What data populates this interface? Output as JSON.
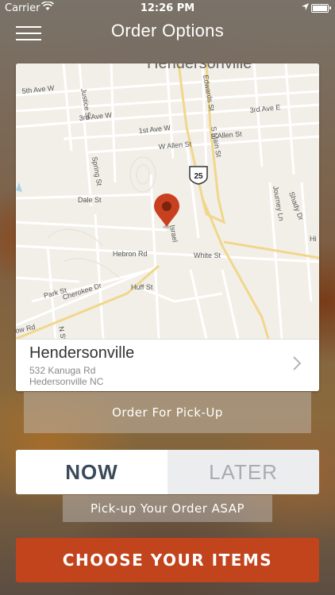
{
  "status_bar": {
    "carrier": "Carrier",
    "time": "12:26 PM"
  },
  "header": {
    "title": "Order Options"
  },
  "map": {
    "city_label": "Hendersonville",
    "route_shield": "25",
    "streets": [
      "5th Ave W",
      "Justice St",
      "3rd Ave W",
      "1st Ave W",
      "W Allen St",
      "E Allen St",
      "Edwards St",
      "S Main St",
      "3rd Ave E",
      "Spring St",
      "Dale St",
      "Journey Ln",
      "Shady Dr",
      "Israel",
      "Hebron Rd",
      "White St",
      "Park St",
      "Cherokee Dr",
      "Huff St",
      "ow Rd",
      "N St",
      "Hi"
    ]
  },
  "location": {
    "name": "Hendersonville",
    "address_line1": "532 Kanuga Rd",
    "address_line2": "Hedersonville NC"
  },
  "order_type": {
    "label": "Order For Pick-Up"
  },
  "timing": {
    "now_label": "NOW",
    "later_label": "LATER",
    "selected": "now",
    "note": "Pick-up Your Order ASAP"
  },
  "cta": {
    "label": "CHOOSE YOUR ITEMS"
  },
  "colors": {
    "accent": "#c1441d",
    "pin": "#c8401f",
    "toggle_text": "#3b4a5a"
  }
}
